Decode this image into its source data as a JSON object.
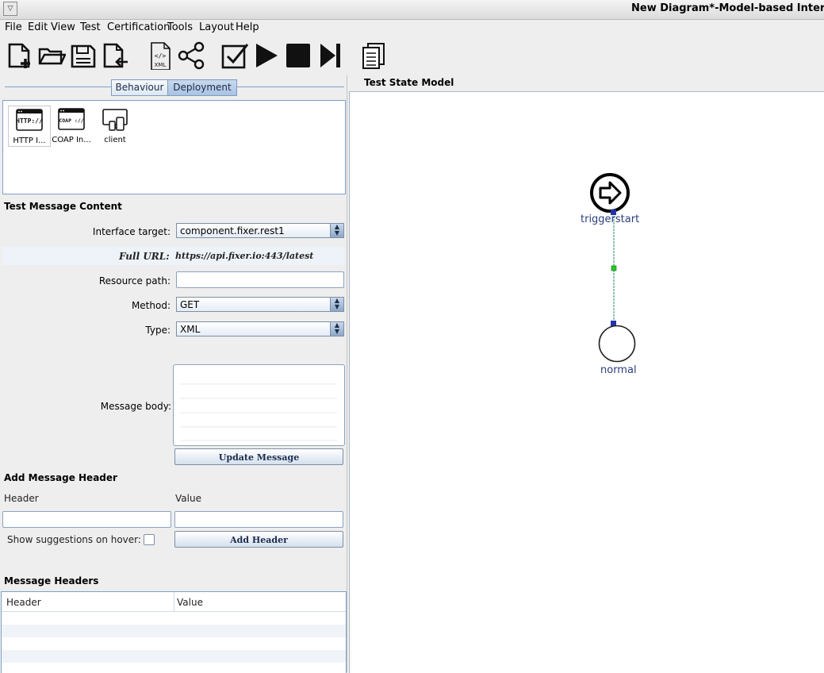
{
  "window": {
    "title": "New Diagram*-Model-based Interopera"
  },
  "menu": [
    "File",
    "Edit",
    "View",
    "Test",
    "Certification",
    "Tools",
    "Layout",
    "Help"
  ],
  "toolbar": {
    "icons": [
      "new-file-icon",
      "open-folder-icon",
      "save-icon",
      "export-icon",
      "xml-icon",
      "share-graph-icon",
      "check-icon",
      "play-icon",
      "stop-icon",
      "step-forward-icon",
      "copy-report-icon"
    ],
    "xml_label": "XML"
  },
  "tabs": {
    "behaviour": "Behaviour",
    "deployment": "Deployment"
  },
  "palette": {
    "items": [
      {
        "label": "HTTP I...",
        "badge": "HTTP://"
      },
      {
        "label": "COAP In...",
        "badge": "COAP ://"
      },
      {
        "label": "client"
      }
    ]
  },
  "message": {
    "section_title": "Test Message Content",
    "interface_label": "Interface target:",
    "interface_value": "component.fixer.rest1",
    "full_url_label": "Full URL:",
    "full_url_value": "https://api.fixer.io:443/latest",
    "resource_label": "Resource path:",
    "resource_value": "",
    "method_label": "Method:",
    "method_value": "GET",
    "type_label": "Type:",
    "type_value": "XML",
    "body_label": "Message body:",
    "update_button": "Update Message"
  },
  "add_header": {
    "section_title": "Add Message Header",
    "header_label": "Header",
    "value_label": "Value",
    "header_value": "",
    "value_value": "",
    "suggestions_label": "Show suggestions on hover:",
    "suggestions_checked": false,
    "add_button": "Add Header"
  },
  "headers_table": {
    "section_title": "Message Headers",
    "columns": [
      "Header",
      "Value"
    ],
    "rows": []
  },
  "diagram": {
    "title": "Test State Model",
    "nodes": {
      "start": "triggerstart",
      "end": "normal"
    },
    "colors": {
      "node_label": "#2c3e7c",
      "edge": "#2a8a6a",
      "handle": "#2233aa",
      "midpoint": "#22cc22"
    }
  }
}
